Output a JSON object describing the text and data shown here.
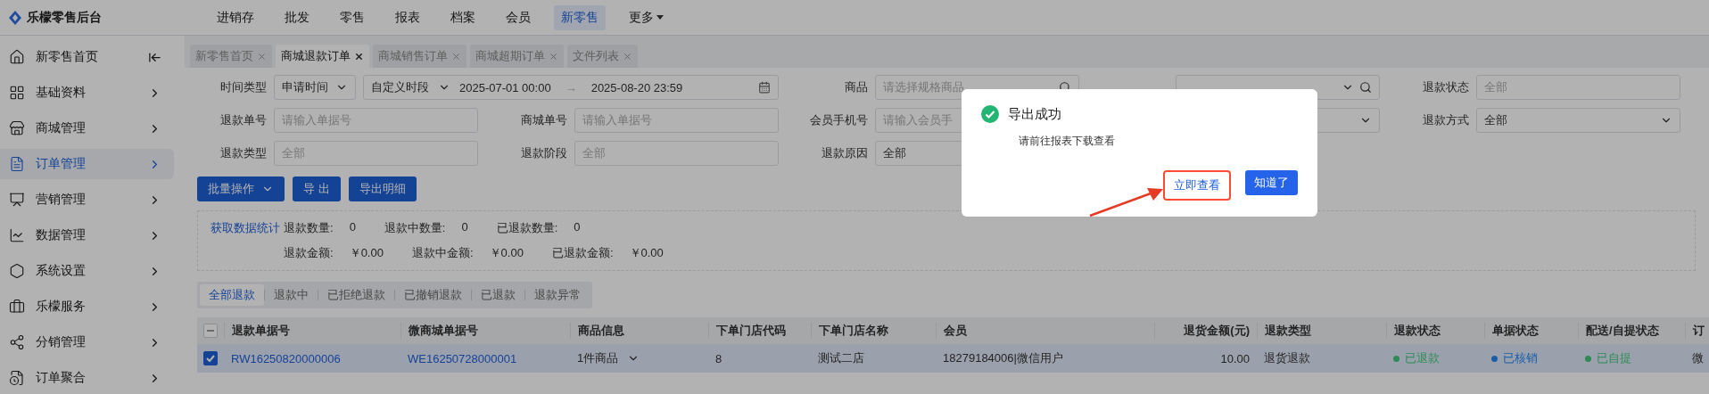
{
  "app": {
    "title": "乐檬零售后台"
  },
  "top_nav": [
    {
      "label": "进销存",
      "selected": false,
      "dropdown": false
    },
    {
      "label": "批发",
      "selected": false,
      "dropdown": false
    },
    {
      "label": "零售",
      "selected": false,
      "dropdown": false
    },
    {
      "label": "报表",
      "selected": false,
      "dropdown": false
    },
    {
      "label": "档案",
      "selected": false,
      "dropdown": false
    },
    {
      "label": "会员",
      "selected": false,
      "dropdown": false
    },
    {
      "label": "新零售",
      "selected": true,
      "dropdown": false
    },
    {
      "label": "更多",
      "selected": false,
      "dropdown": true
    }
  ],
  "sidebar": {
    "items": [
      {
        "label": "新零售首页",
        "selected": false
      },
      {
        "label": "基础资料",
        "selected": false
      },
      {
        "label": "商城管理",
        "selected": false
      },
      {
        "label": "订单管理",
        "selected": true
      },
      {
        "label": "营销管理",
        "selected": false
      },
      {
        "label": "数据管理",
        "selected": false
      },
      {
        "label": "系统设置",
        "selected": false
      },
      {
        "label": "乐檬服务",
        "selected": false
      },
      {
        "label": "分销管理",
        "selected": false
      },
      {
        "label": "订单聚合",
        "selected": false
      }
    ]
  },
  "tabs": [
    {
      "label": "新零售首页",
      "selected": false
    },
    {
      "label": "商城退款订单",
      "selected": true
    },
    {
      "label": "商城销售订单",
      "selected": false
    },
    {
      "label": "商城超期订单",
      "selected": false
    },
    {
      "label": "文件列表",
      "selected": false
    }
  ],
  "filters": {
    "rows": [
      [
        {
          "kind": "time",
          "label": "时间类型",
          "type_value": "申请时间",
          "period_value": "自定义时段",
          "start": "2025-07-01 00:00",
          "separator": "→",
          "end": "2025-08-20 23:59"
        },
        "",
        {
          "kind": "search",
          "label": "商品",
          "placeholder": "请选择规格商品"
        },
        {
          "kind": "search_select"
        },
        {
          "kind": "input",
          "label": "退款状态",
          "placeholder": "全部"
        }
      ],
      [
        {
          "kind": "input",
          "label": "退款单号",
          "placeholder": "请输入单据号"
        },
        {
          "kind": "input",
          "label": "商城单号",
          "placeholder": "请输入单据号"
        },
        {
          "kind": "input",
          "label": "会员手机号",
          "placeholder": "请输入会员手"
        },
        {
          "kind": "select"
        },
        {
          "kind": "select",
          "label": "退款方式",
          "value": "全部"
        }
      ],
      [
        {
          "kind": "input",
          "label": "退款类型",
          "placeholder": "全部"
        },
        {
          "kind": "input",
          "label": "退款阶段",
          "placeholder": "全部"
        },
        {
          "kind": "select",
          "label": "退款原因",
          "value": "全部"
        }
      ]
    ]
  },
  "actions": [
    {
      "label": "批量操作",
      "kind": "dropdown"
    },
    {
      "label": "导 出",
      "kind": "plain"
    },
    {
      "label": "导出明细",
      "kind": "plain"
    }
  ],
  "stats": {
    "link": "获取数据统计",
    "rows": [
      [
        {
          "label": "退款数量:",
          "value": "0"
        },
        {
          "label": "退款中数量:",
          "value": "0"
        },
        {
          "label": "已退款数量:",
          "value": "0"
        }
      ],
      [
        {
          "label": "退款金额:",
          "value": "￥0.00"
        },
        {
          "label": "退款中金额:",
          "value": "￥0.00"
        },
        {
          "label": "已退款金额:",
          "value": "￥0.00"
        }
      ]
    ]
  },
  "status_tabs": [
    {
      "label": "全部退款",
      "selected": true
    },
    {
      "label": "退款中",
      "selected": false
    },
    {
      "label": "已拒绝退款",
      "selected": false
    },
    {
      "label": "已撤销退款",
      "selected": false
    },
    {
      "label": "已退款",
      "selected": false
    },
    {
      "label": "退款异常",
      "selected": false
    }
  ],
  "table": {
    "select_all_partial": true,
    "columns": [
      "退款单据号",
      "微商城单据号",
      "商品信息",
      "下单门店代码",
      "下单门店名称",
      "会员",
      "退货金额(元)",
      "退款类型",
      "退款状态",
      "单据状态",
      "配送/自提状态",
      "订"
    ],
    "rows": [
      {
        "selected": true,
        "cells": [
          {
            "kind": "link",
            "text": "RW16250820000006"
          },
          {
            "kind": "link",
            "text": "WE16250728000001"
          },
          {
            "kind": "expand",
            "text": "1件商品"
          },
          {
            "kind": "text",
            "text": "8"
          },
          {
            "kind": "text",
            "text": "测试二店"
          },
          {
            "kind": "text",
            "text": "18279184006|微信用户"
          },
          {
            "kind": "amount",
            "text": "10.00"
          },
          {
            "kind": "text",
            "text": "退货退款"
          },
          {
            "kind": "status",
            "text": "已退款",
            "color": "#2e8b57"
          },
          {
            "kind": "status",
            "text": "已核销",
            "color": "#1a5fa8"
          },
          {
            "kind": "status",
            "text": "已自提",
            "color": "#2e8b57"
          },
          {
            "kind": "text",
            "text": "微"
          }
        ]
      }
    ]
  },
  "modal": {
    "title": "导出成功",
    "message": "请前往报表下载查看",
    "buttons": [
      {
        "label": "立即查看",
        "kind": "link",
        "highlighted": true
      },
      {
        "label": "知道了",
        "kind": "primary",
        "highlighted": false
      }
    ]
  }
}
